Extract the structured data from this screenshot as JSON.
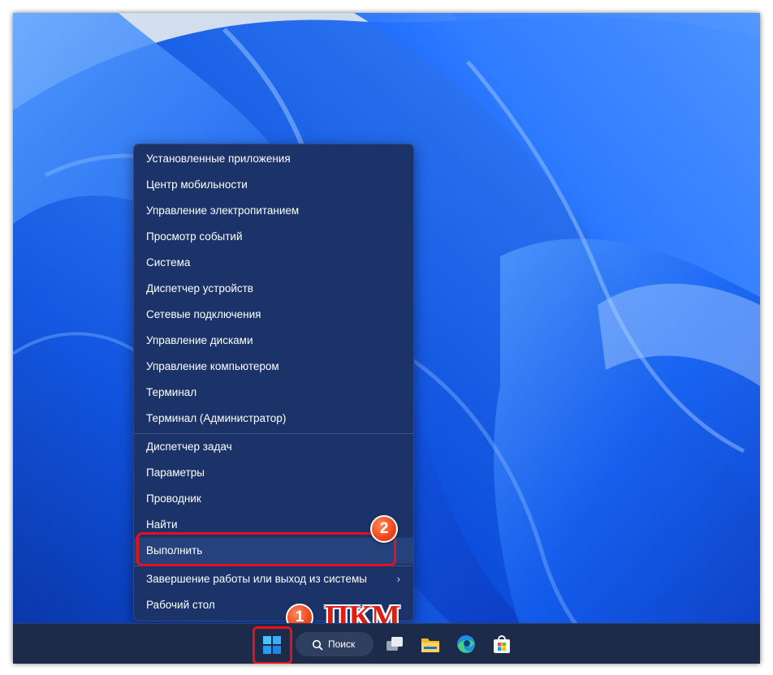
{
  "context_menu": {
    "group1": [
      "Установленные приложения",
      "Центр мобильности",
      "Управление электропитанием",
      "Просмотр событий",
      "Система",
      "Диспетчер устройств",
      "Сетевые подключения",
      "Управление дисками",
      "Управление компьютером",
      "Терминал",
      "Терминал (Администратор)"
    ],
    "group2": [
      "Диспетчер задач",
      "Параметры",
      "Проводник",
      "Найти",
      "Выполнить",
      "Завершение работы или выход из системы",
      "Рабочий стол"
    ],
    "selected_item": "Выполнить",
    "submenu_arrow": "›"
  },
  "annotations": {
    "step1_badge": "1",
    "step2_badge": "2",
    "step1_caption": "ПКМ",
    "highlight_color": "#e8111b"
  },
  "taskbar": {
    "search_label": "Поиск",
    "icons": [
      "start-icon",
      "search-icon",
      "task-view-icon",
      "file-explorer-icon",
      "edge-icon",
      "store-icon"
    ]
  },
  "colors": {
    "menu_background": "#1b3369",
    "taskbar_background": "#1c2b4a",
    "wallpaper_blue": "#1356e6"
  }
}
